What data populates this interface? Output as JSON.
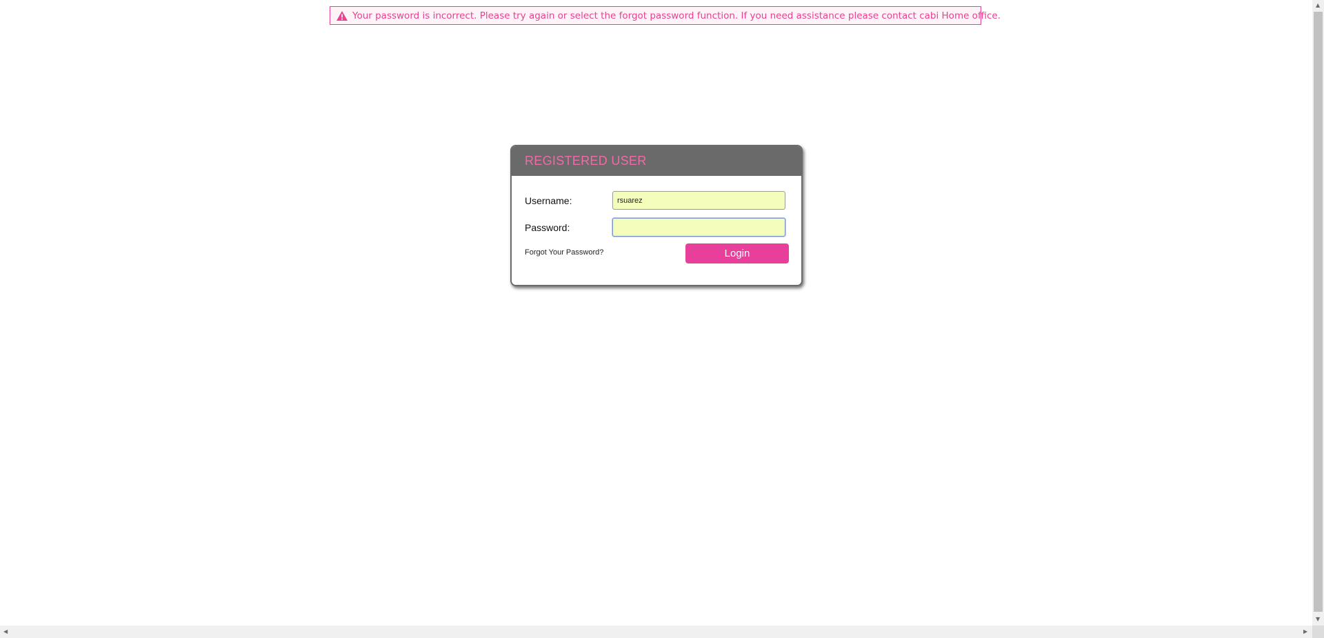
{
  "error": {
    "message": "Your password is incorrect. Please try again or select the forgot password function. If you need assistance please contact cabi Home office.",
    "icon": "warning-triangle-icon",
    "color": "#e8418f"
  },
  "panel": {
    "title": "REGISTERED USER",
    "username_label": "Username:",
    "username_value": "rsuarez",
    "password_label": "Password:",
    "password_value": "",
    "forgot_label": "Forgot Your Password?",
    "login_label": "Login"
  },
  "colors": {
    "accent": "#e8409a",
    "header_bg": "#6a6a6b",
    "input_bg": "#f5fdbc"
  }
}
